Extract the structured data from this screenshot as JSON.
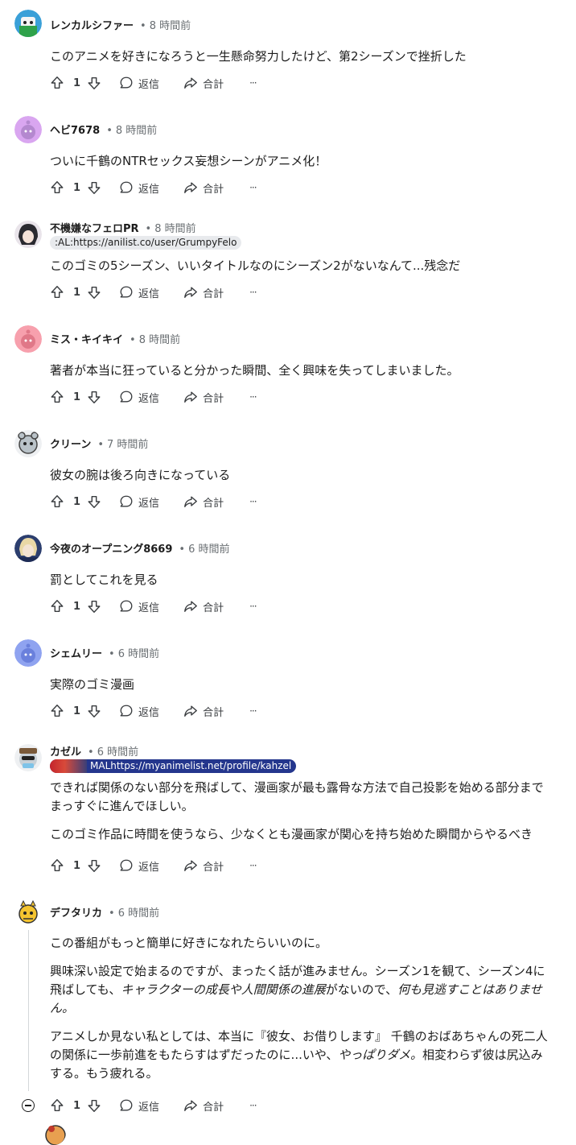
{
  "icons": {
    "upvote": "upvote-arrow-icon",
    "downvote": "downvote-arrow-icon",
    "reply": "speech-bubble-icon",
    "share": "share-arrow-icon",
    "more": "ellipsis-icon"
  },
  "actions": {
    "reply_label": "返信",
    "share_label": "合計",
    "more_label": "···"
  },
  "comments": [
    {
      "username": "レンカルシファー",
      "time": "8 時間前",
      "score": "1",
      "paragraphs": [
        "このアニメを好きになろうと一生懸命努力したけど、第2シーズンで挫折した"
      ]
    },
    {
      "username": "ヘビ7678",
      "time": "8 時間前",
      "score": "1",
      "paragraphs": [
        "ついに千鶴のNTRセックス妄想シーンがアニメ化！"
      ]
    },
    {
      "username": "不機嫌なフェロPR",
      "time": "8 時間前",
      "score": "1",
      "flair": ":AL:https://anilist.co/user/GrumpyFelo",
      "paragraphs": [
        "このゴミの5シーズン、いいタイトルなのにシーズン2がないなんて...残念だ"
      ]
    },
    {
      "username": "ミス・キイキイ",
      "time": "8 時間前",
      "score": "1",
      "paragraphs": [
        "著者が本当に狂っていると分かった瞬間、全く興味を失ってしまいました。"
      ]
    },
    {
      "username": "クリーン",
      "time": "7 時間前",
      "score": "1",
      "paragraphs": [
        "彼女の腕は後ろ向きになっている"
      ]
    },
    {
      "username": "今夜のオープニング8669",
      "time": "6 時間前",
      "score": "1",
      "paragraphs": [
        "罰としてこれを見る"
      ]
    },
    {
      "username": "シェムリー",
      "time": "6 時間前",
      "score": "1",
      "paragraphs": [
        "実際のゴミ漫画"
      ]
    },
    {
      "username": "カゼル",
      "time": "6 時間前",
      "score": "1",
      "flair": "MALhttps://myanimelist.net/profile/kahzel",
      "paragraphs": [
        "できれば関係のない部分を飛ばして、漫画家が最も露骨な方法で自己投影を始める部分までまっすぐに進んでほしい。",
        "このゴミ作品に時間を使うなら、少なくとも漫画家が関心を持ち始めた瞬間からやるべき"
      ]
    },
    {
      "username": "デフタリカ",
      "time": "6 時間前",
      "score": "1",
      "paragraphs": [
        "この番組がもっと簡単に好きになれたらいいのに。",
        "興味深い設定で始まるのですが、まったく話が進みません。シーズン1を観て、シーズン4に飛ばしても、",
        "キャラクターの成長や人間関係の進展",
        "がないので、",
        "何も見逃すことはありません。",
        "アニメしか見ない私としては、本当に『彼女、お借りします』 千鶴のおばあちゃんの死二人の関係に一歩前進をもたらすはずだったのに...いや、",
        "やっぱりダメ。",
        "相変わらず彼は尻込みする。もう疲れる。"
      ]
    }
  ]
}
